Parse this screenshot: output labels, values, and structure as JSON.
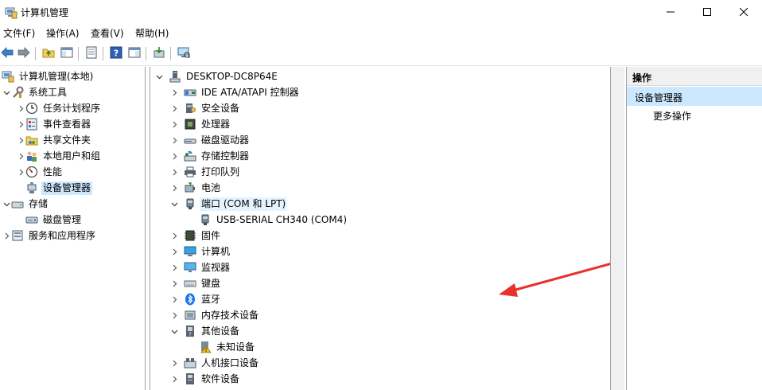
{
  "window": {
    "title": "计算机管理",
    "controls": {
      "minimize": "minimize-icon",
      "maximize": "maximize-icon",
      "close": "close-icon"
    }
  },
  "menubar": {
    "items": [
      {
        "label": "文件(F)"
      },
      {
        "label": "操作(A)"
      },
      {
        "label": "查看(V)"
      },
      {
        "label": "帮助(H)"
      }
    ]
  },
  "toolbar": {
    "icons": [
      "back-icon",
      "forward-icon",
      "up-folder-icon",
      "show-hide-tree-icon",
      "properties-icon",
      "help-icon",
      "console-tree-icon",
      "update-driver-icon",
      "scan-hardware-icon"
    ]
  },
  "left_tree": {
    "items": [
      {
        "label": "计算机管理(本地)",
        "icon": "computer-management-icon"
      },
      {
        "label": "系统工具",
        "icon": "tools-icon"
      },
      {
        "label": "任务计划程序",
        "icon": "clock-icon"
      },
      {
        "label": "事件查看器",
        "icon": "event-viewer-icon"
      },
      {
        "label": "共享文件夹",
        "icon": "shared-folder-icon"
      },
      {
        "label": "本地用户和组",
        "icon": "users-icon"
      },
      {
        "label": "性能",
        "icon": "performance-icon"
      },
      {
        "label": "设备管理器",
        "icon": "device-manager-icon"
      },
      {
        "label": "存储",
        "icon": "storage-icon"
      },
      {
        "label": "磁盘管理",
        "icon": "disk-icon"
      },
      {
        "label": "服务和应用程序",
        "icon": "services-icon"
      }
    ]
  },
  "device_tree": {
    "root": "DESKTOP-DC8P64E",
    "items": [
      {
        "label": "IDE ATA/ATAPI 控制器",
        "icon": "ide-icon"
      },
      {
        "label": "安全设备",
        "icon": "security-device-icon"
      },
      {
        "label": "处理器",
        "icon": "processor-icon"
      },
      {
        "label": "磁盘驱动器",
        "icon": "disk-drive-icon"
      },
      {
        "label": "存储控制器",
        "icon": "storage-controller-icon"
      },
      {
        "label": "打印队列",
        "icon": "printer-icon"
      },
      {
        "label": "电池",
        "icon": "battery-icon"
      },
      {
        "label": "端口 (COM 和 LPT)",
        "icon": "port-icon"
      },
      {
        "label": "USB-SERIAL CH340 (COM4)",
        "icon": "port-icon"
      },
      {
        "label": "固件",
        "icon": "firmware-icon"
      },
      {
        "label": "计算机",
        "icon": "computer-icon"
      },
      {
        "label": "监视器",
        "icon": "monitor-icon"
      },
      {
        "label": "键盘",
        "icon": "keyboard-icon"
      },
      {
        "label": "蓝牙",
        "icon": "bluetooth-icon"
      },
      {
        "label": "内存技术设备",
        "icon": "memory-icon"
      },
      {
        "label": "其他设备",
        "icon": "other-devices-icon"
      },
      {
        "label": "未知设备",
        "icon": "unknown-device-warning-icon"
      },
      {
        "label": "人机接口设备",
        "icon": "hid-icon"
      },
      {
        "label": "软件设备",
        "icon": "software-device-icon"
      }
    ]
  },
  "actions_pane": {
    "header": "操作",
    "section": "设备管理器",
    "more": "更多操作"
  },
  "colors": {
    "selection": "#cce8ff",
    "annotation_arrow": "#e8312a",
    "bluetooth": "#1a73e8"
  }
}
